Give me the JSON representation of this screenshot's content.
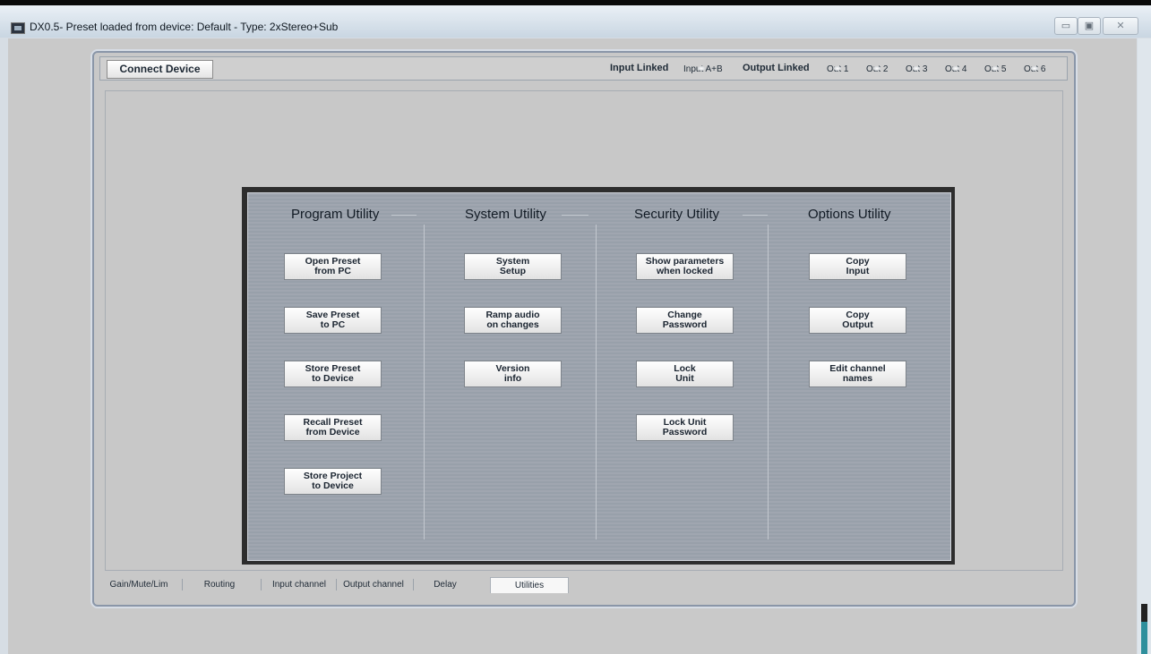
{
  "window": {
    "title": "DX0.5- Preset loaded from device: Default - Type: 2xStereo+Sub",
    "controls": [
      "▭",
      "▣",
      "✕"
    ]
  },
  "toolbar": {
    "connect_label": "Connect Device",
    "input_linked_label": "Input Linked",
    "input_channels": [
      "Input A+B"
    ],
    "output_linked_label": "Output Linked",
    "output_channels": [
      "Out 1",
      "Out 2",
      "Out 3",
      "Out 4",
      "Out 5",
      "Out 6"
    ]
  },
  "utilities": {
    "columns": [
      {
        "title": "Program Utility",
        "buttons": [
          "Open Preset\nfrom PC",
          "Save Preset\nto PC",
          "Store Preset\nto Device",
          "Recall Preset\nfrom Device",
          "Store Project\nto Device"
        ]
      },
      {
        "title": "System Utility",
        "buttons": [
          "System\nSetup",
          "Ramp audio\non changes",
          "Version\ninfo"
        ]
      },
      {
        "title": "Security Utility",
        "buttons": [
          "Show parameters\nwhen locked",
          "Change\nPassword",
          "Lock\nUnit",
          "Lock Unit\nPassword"
        ]
      },
      {
        "title": "Options Utility",
        "buttons": [
          "Copy\nInput",
          "Copy\nOutput",
          "Edit channel\nnames"
        ]
      }
    ]
  },
  "tabs": [
    {
      "label": "Gain/Mute/Lim",
      "active": false
    },
    {
      "label": "Routing",
      "active": false
    },
    {
      "label": "Input channel",
      "active": false
    },
    {
      "label": "Output channel",
      "active": false
    },
    {
      "label": "Delay",
      "active": false
    },
    {
      "label": "Utilities",
      "active": true
    }
  ]
}
